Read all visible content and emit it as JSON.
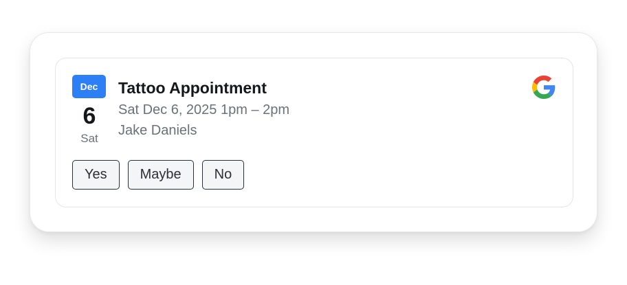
{
  "event": {
    "month": "Dec",
    "day": "6",
    "weekday": "Sat",
    "title": "Tattoo Appointment",
    "when": "Sat Dec 6, 2025 1pm – 2pm",
    "organizer": "Jake Daniels"
  },
  "provider": {
    "icon": "google-logo-icon",
    "colors": {
      "blue": "#4285F4",
      "red": "#EA4335",
      "yellow": "#FBBC05",
      "green": "#34A853"
    }
  },
  "rsvp": {
    "yes_label": "Yes",
    "maybe_label": "Maybe",
    "no_label": "No"
  },
  "colors": {
    "accent": "#2d7ff5"
  }
}
